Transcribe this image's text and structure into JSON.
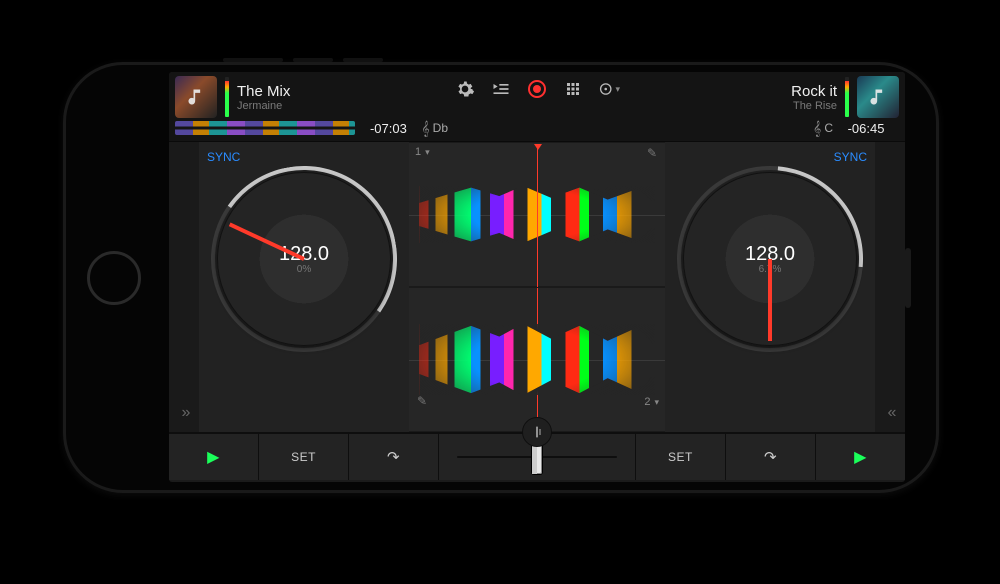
{
  "deck_left": {
    "track_title": "The Mix",
    "track_artist": "Jermaine",
    "time_remaining": "-07:03",
    "key": "Db",
    "sync_label": "SYNC",
    "bpm": "128.0",
    "pitch": "0%",
    "lane_number": "1",
    "expand_glyph": "»"
  },
  "deck_right": {
    "track_title": "Rock it",
    "track_artist": "The Rise",
    "time_remaining": "-06:45",
    "key": "C",
    "sync_label": "SYNC",
    "bpm": "128.0",
    "pitch": "6.7%",
    "lane_number": "2",
    "expand_glyph": "«"
  },
  "header_icons": {
    "settings": "gear",
    "queue": "queue",
    "record": "record",
    "pads": "grid",
    "automix": "disc"
  },
  "footer": {
    "play_glyph": "▶",
    "set_label": "SET",
    "jump_glyph": "↷"
  },
  "colors": {
    "accent_sync": "#2a8cff",
    "accent_play": "#1aff5a",
    "accent_record": "#ff3030",
    "playhead": "#ff3a2a"
  }
}
